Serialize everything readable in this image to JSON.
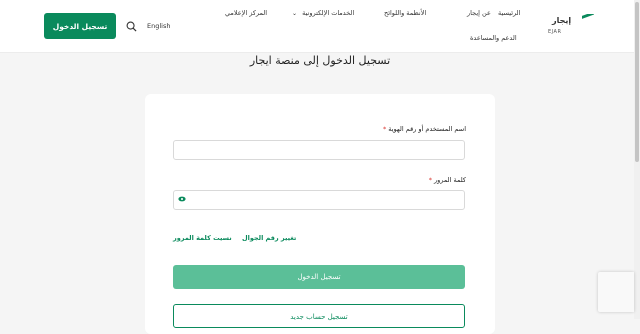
{
  "brand": {
    "name_ar": "إيجار",
    "name_en": "EJAR"
  },
  "nav": {
    "home": "الرئيسية",
    "about": "عن إيجار",
    "regulations": "الأنظمة واللوائح",
    "eservices": "الخدمات الإلكترونية",
    "media": "المركز الإعلامي",
    "support": "الدعم والمساعدة"
  },
  "header": {
    "language": "English",
    "login_label": "تسجيل الدخول"
  },
  "page": {
    "title": "تسجيل الدخول إلى منصة ايجار"
  },
  "form": {
    "username_label": "اسم المستخدم أو رقم الهوية",
    "password_label": "كلمة المرور",
    "required_mark": "*",
    "change_phone_link": "تغيير رقم الجوال",
    "forgot_password_link": "نسيت كلمة المرور",
    "submit_label": "تسجيل الدخول",
    "register_label": "تسجيل حساب جديد"
  },
  "colors": {
    "brand": "#0a8a5c",
    "button_light": "#5bbf98",
    "required": "#d9352f"
  }
}
